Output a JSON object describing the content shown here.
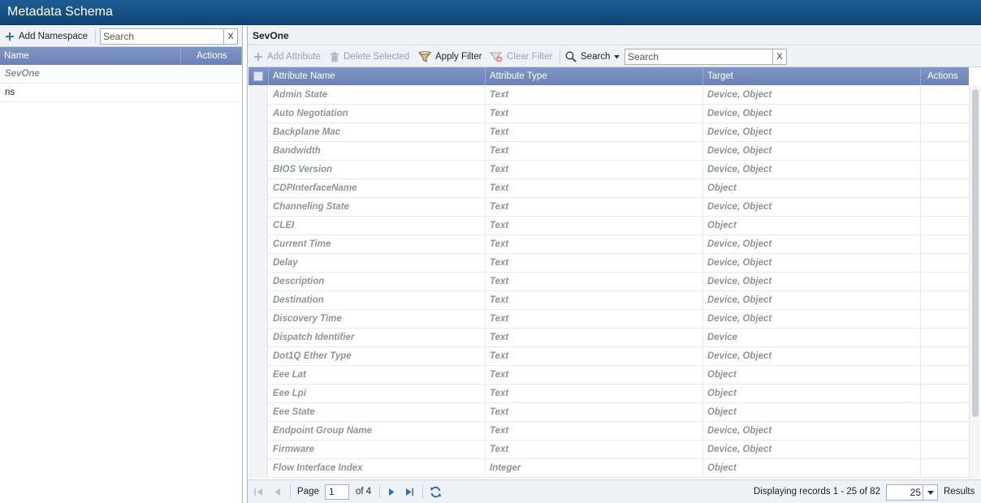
{
  "app": {
    "title": "Metadata Schema"
  },
  "left": {
    "add_namespace_label": "Add Namespace",
    "search_placeholder": "Search",
    "clear_label": "X",
    "columns": {
      "name": "Name",
      "actions": "Actions"
    },
    "namespaces": [
      "SevOne",
      "ns"
    ]
  },
  "right": {
    "panel_title": "SevOne",
    "toolbar": {
      "add_attribute": "Add Attribute",
      "delete_selected": "Delete Selected",
      "apply_filter": "Apply Filter",
      "clear_filter": "Clear Filter",
      "search_menu": "Search",
      "search_placeholder": "Search",
      "clear_label": "X"
    },
    "columns": {
      "attribute_name": "Attribute Name",
      "attribute_type": "Attribute Type",
      "target": "Target",
      "actions": "Actions"
    },
    "rows": [
      {
        "name": "Admin State",
        "type": "Text",
        "target": "Device, Object"
      },
      {
        "name": "Auto Negotiation",
        "type": "Text",
        "target": "Device, Object"
      },
      {
        "name": "Backplane Mac",
        "type": "Text",
        "target": "Device, Object"
      },
      {
        "name": "Bandwidth",
        "type": "Text",
        "target": "Device, Object"
      },
      {
        "name": "BIOS Version",
        "type": "Text",
        "target": "Device, Object"
      },
      {
        "name": "CDPInterfaceName",
        "type": "Text",
        "target": "Object"
      },
      {
        "name": "Channeling State",
        "type": "Text",
        "target": "Device, Object"
      },
      {
        "name": "CLEI",
        "type": "Text",
        "target": "Object"
      },
      {
        "name": "Current Time",
        "type": "Text",
        "target": "Device, Object"
      },
      {
        "name": "Delay",
        "type": "Text",
        "target": "Device, Object"
      },
      {
        "name": "Description",
        "type": "Text",
        "target": "Device, Object"
      },
      {
        "name": "Destination",
        "type": "Text",
        "target": "Device, Object"
      },
      {
        "name": "Discovery Time",
        "type": "Text",
        "target": "Device, Object"
      },
      {
        "name": "Dispatch Identifier",
        "type": "Text",
        "target": "Device"
      },
      {
        "name": "Dot1Q Ether Type",
        "type": "Text",
        "target": "Device, Object"
      },
      {
        "name": "Eee Lat",
        "type": "Text",
        "target": "Object"
      },
      {
        "name": "Eee Lpi",
        "type": "Text",
        "target": "Object"
      },
      {
        "name": "Eee State",
        "type": "Text",
        "target": "Object"
      },
      {
        "name": "Endpoint Group Name",
        "type": "Text",
        "target": "Device, Object"
      },
      {
        "name": "Firmware",
        "type": "Text",
        "target": "Device, Object"
      },
      {
        "name": "Flow Interface Index",
        "type": "Integer",
        "target": "Object"
      }
    ],
    "footer": {
      "page_label": "Page",
      "page_value": "1",
      "of_label": "of 4",
      "displaying": "Displaying records 1 - 25 of 82",
      "page_size": "25",
      "results_label": "Results"
    }
  },
  "colors": {
    "titlebar": "#0f4476",
    "grid_header": "#7089bb",
    "toolbar_bg": "#eef2f7",
    "muted_text": "#8f949b"
  }
}
